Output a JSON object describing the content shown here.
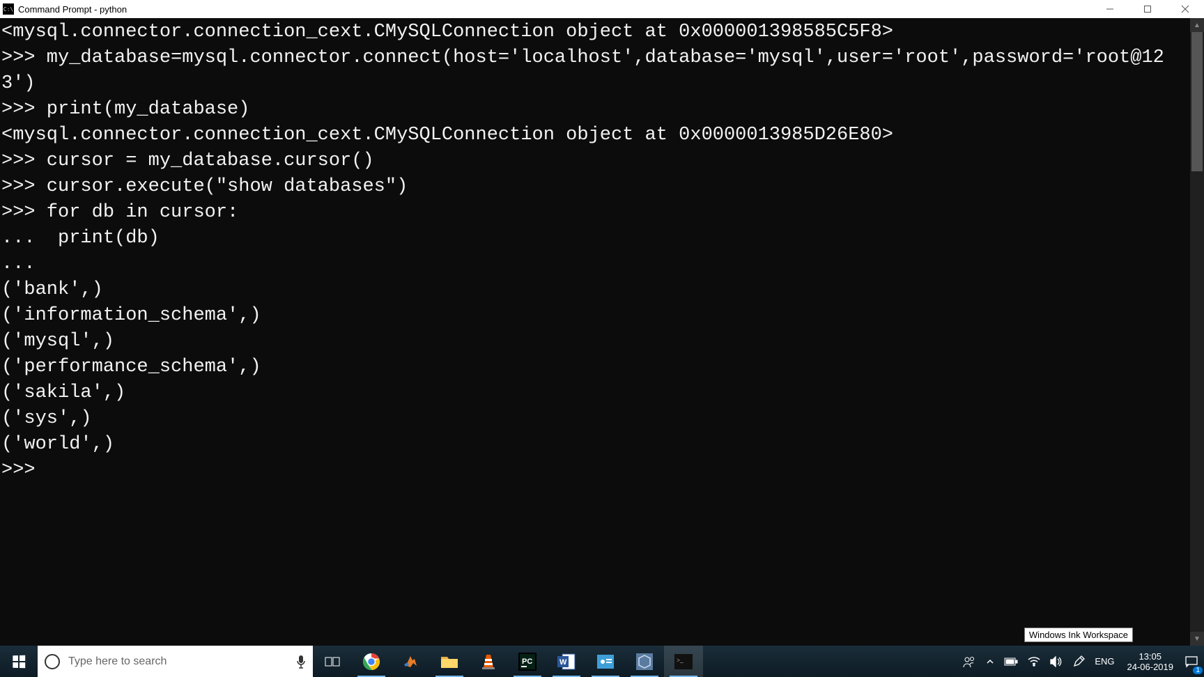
{
  "window": {
    "title": "Command Prompt - python",
    "icon_label": "C:\\"
  },
  "console_lines": [
    "<mysql.connector.connection_cext.CMySQLConnection object at 0x000001398585C5F8>",
    ">>> my_database=mysql.connector.connect(host='localhost',database='mysql',user='root',password='root@123')",
    ">>> print(my_database)",
    "<mysql.connector.connection_cext.CMySQLConnection object at 0x0000013985D26E80>",
    ">>> cursor = my_database.cursor()",
    ">>> cursor.execute(\"show databases\")",
    ">>> for db in cursor:",
    "...  print(db)",
    "...",
    "('bank',)",
    "('information_schema',)",
    "('mysql',)",
    "('performance_schema',)",
    "('sakila',)",
    "('sys',)",
    "('world',)",
    ">>> "
  ],
  "tooltip": "Windows Ink Workspace",
  "taskbar": {
    "search_placeholder": "Type here to search",
    "lang": "ENG",
    "time": "13:05",
    "date": "24-06-2019",
    "notification_count": "1"
  }
}
